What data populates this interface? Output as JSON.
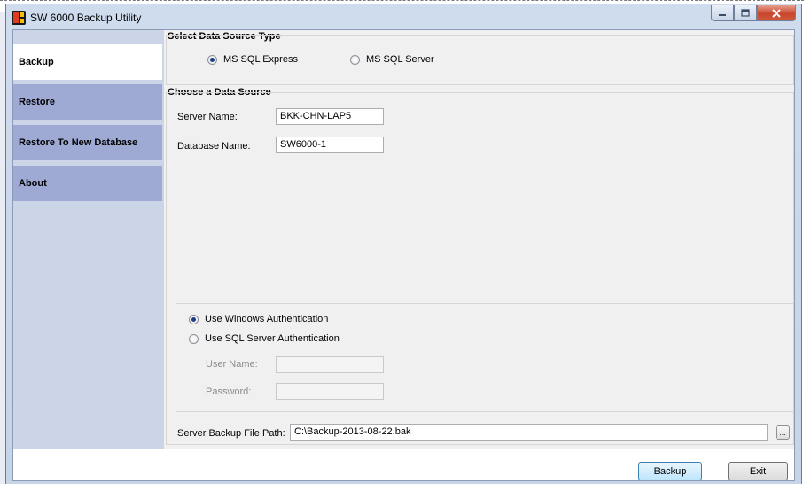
{
  "window": {
    "title": "SW 6000 Backup Utility"
  },
  "sidebar": {
    "items": [
      {
        "label": "Backup"
      },
      {
        "label": "Restore"
      },
      {
        "label": "Restore To New Database"
      },
      {
        "label": "About"
      }
    ]
  },
  "data_source_type": {
    "title": "Select Data Source Type",
    "options": [
      {
        "label": "MS SQL Express"
      },
      {
        "label": "MS SQL Server"
      }
    ]
  },
  "data_source": {
    "title": "Choose a Data Source",
    "server_name_label": "Server Name:",
    "server_name_value": "BKK-CHN-LAP5",
    "database_name_label": "Database Name:",
    "database_name_value": "SW6000-1"
  },
  "auth": {
    "windows_label": "Use Windows Authentication",
    "sql_label": "Use SQL Server Authentication",
    "user_name_label": "User Name:",
    "password_label": "Password:"
  },
  "backup_path": {
    "label": "Server Backup File Path:",
    "value": "C:\\Backup-2013-08-22.bak",
    "browse_label": "..."
  },
  "buttons": {
    "backup_label": "Backup",
    "exit_label": "Exit"
  },
  "icons": {
    "caption_min": "minimize-icon",
    "caption_max": "maximize-icon",
    "caption_close": "close-icon",
    "app": "app-icon"
  }
}
